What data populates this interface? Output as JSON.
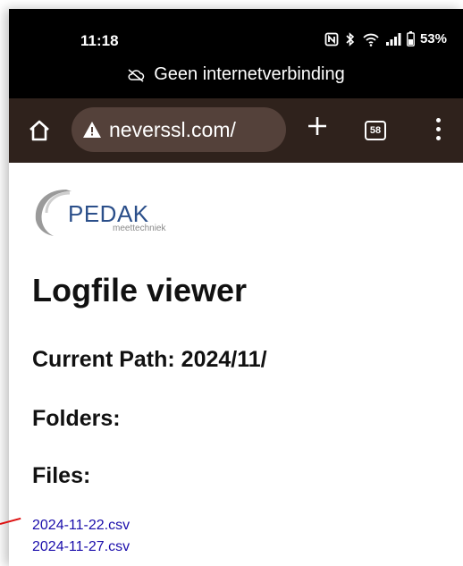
{
  "status_bar": {
    "time": "11:18",
    "battery": "53%",
    "icons": [
      "nfc-icon",
      "bluetooth-icon",
      "wifi-icon",
      "signal-icon",
      "battery-icon"
    ],
    "offline_icon": "cloud-off-icon",
    "offline_text": "Geen internetverbinding"
  },
  "toolbar": {
    "home_icon": "home-icon",
    "url_warning_icon": "warning-icon",
    "url": "neverssl.com/",
    "new_tab_icon": "plus-icon",
    "tab_count": "58",
    "menu_icon": "more-vert-icon"
  },
  "page": {
    "logo": {
      "brand": "PEDAK",
      "tagline": "meettechniek"
    },
    "title": "Logfile viewer",
    "current_path": "Current Path: 2024/11/",
    "folders_heading": "Folders:",
    "files_heading": "Files:",
    "files": [
      "2024-11-22.csv",
      "2024-11-27.csv"
    ]
  },
  "colors": {
    "status_bg": "#000000",
    "toolbar_bg": "#2f221c",
    "urlbar_bg": "#54413a",
    "link": "#1a0dab",
    "logo_blue": "#2b4f8a"
  }
}
